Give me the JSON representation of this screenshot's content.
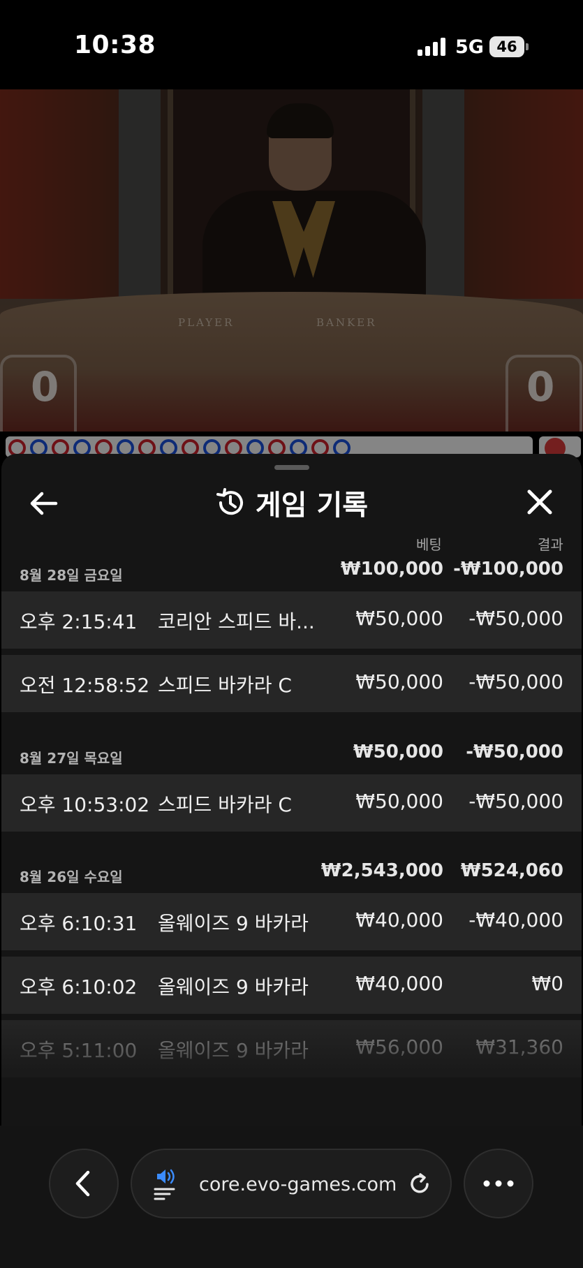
{
  "status_bar": {
    "time": "10:38",
    "network": "5G",
    "battery": "46"
  },
  "video": {
    "table_player_label": "PLAYER",
    "table_banker_label": "BANKER",
    "player_score": "0",
    "banker_score": "0"
  },
  "sheet": {
    "title": "게임 기록",
    "col_bet": "베팅",
    "col_result": "결과",
    "days": [
      {
        "label": "8월 28일 금요일",
        "bet": "₩100,000",
        "result": "-₩100,000",
        "games": [
          {
            "time": "오후 2:15:41",
            "name": "코리안 스피드 바...",
            "bet": "₩50,000",
            "result": "-₩50,000"
          },
          {
            "time": "오전 12:58:52",
            "name": "스피드 바카라 C",
            "bet": "₩50,000",
            "result": "-₩50,000"
          }
        ]
      },
      {
        "label": "8월 27일 목요일",
        "bet": "₩50,000",
        "result": "-₩50,000",
        "games": [
          {
            "time": "오후 10:53:02",
            "name": "스피드 바카라 C",
            "bet": "₩50,000",
            "result": "-₩50,000"
          }
        ]
      },
      {
        "label": "8월 26일 수요일",
        "bet": "₩2,543,000",
        "result": "₩524,060",
        "games": [
          {
            "time": "오후 6:10:31",
            "name": "올웨이즈 9 바카라",
            "bet": "₩40,000",
            "result": "-₩40,000"
          },
          {
            "time": "오후 6:10:02",
            "name": "올웨이즈 9 바카라",
            "bet": "₩40,000",
            "result": "₩0"
          },
          {
            "time": "오후 5:11:00",
            "name": "올웨이즈 9 바카라",
            "bet": "₩56,000",
            "result": "₩31,360"
          }
        ]
      }
    ]
  },
  "browser": {
    "url": "core.evo-games.com"
  },
  "colors": {
    "sheet_bg": "#151515",
    "row_bg": "#262626",
    "audio_icon": "#3b8cff"
  }
}
